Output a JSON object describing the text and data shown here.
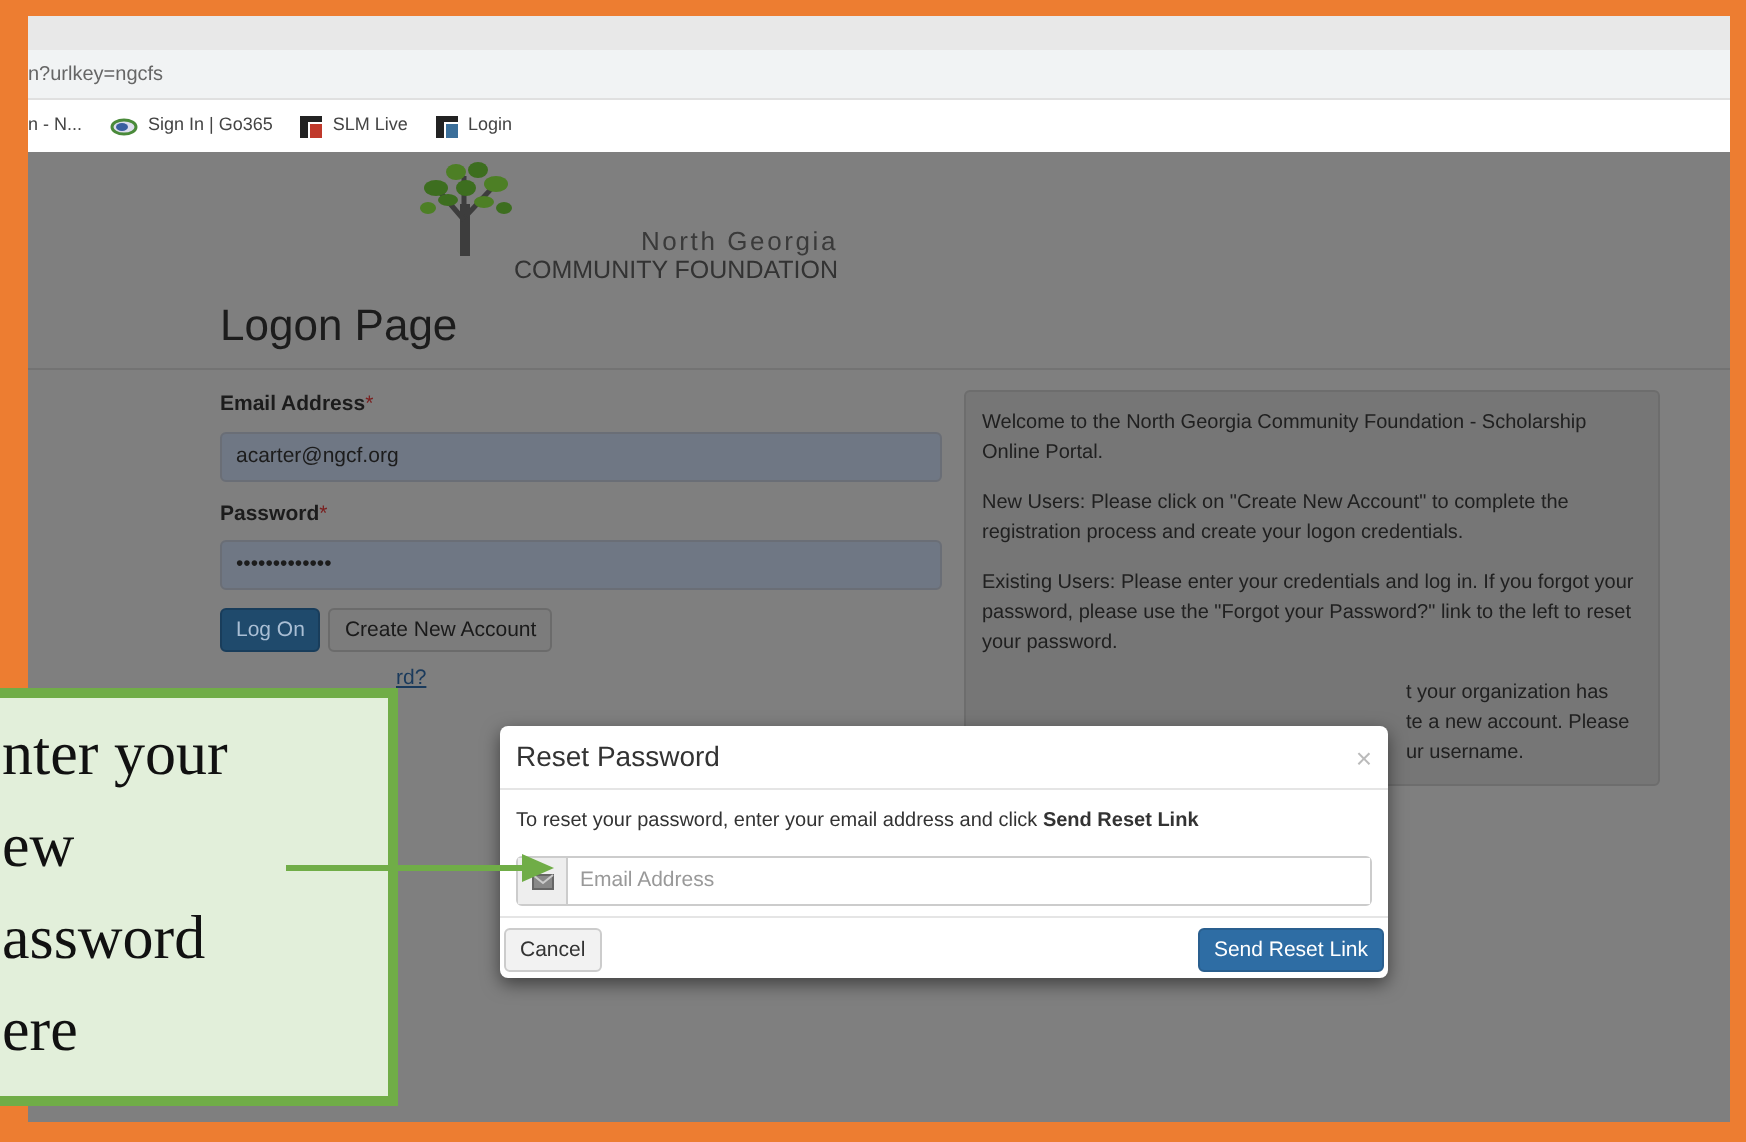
{
  "browser": {
    "address": "n?urlkey=ngcfs",
    "bookmarks": [
      {
        "label": "n - N...",
        "kind": "text"
      },
      {
        "label": "Sign In | Go365",
        "kind": "oval"
      },
      {
        "label": "SLM Live",
        "kind": "tile",
        "color": "#c0392b"
      },
      {
        "label": "Login",
        "kind": "tile",
        "color": "#3b6f9a"
      }
    ]
  },
  "logo": {
    "line_1": "North Georgia",
    "line_2": "COMMUNITY FOUNDATION"
  },
  "heading": "Logon Page",
  "fields": [
    {
      "label": "Email Address",
      "marker": "*",
      "value": "acarter@ngcf.org"
    },
    {
      "label": "Password",
      "marker": "*",
      "value": "•••••••••••••"
    }
  ],
  "buttons": [
    {
      "label": "Log On",
      "kind": "primary"
    },
    {
      "label": "Create New Account",
      "kind": "default"
    }
  ],
  "forgot_link": "rd?",
  "info_panel": {
    "paragraphs": [
      "Welcome to the North Georgia Community Foundation - Scholarship Online Portal.",
      "New Users: Please click on \"Create New Account\" to complete the registration process and create your logon credentials.",
      "Existing Users: Please enter your credentials and log in. If you forgot your password, please use the \"Forgot your Password?\" link to the left to reset your password."
    ],
    "partial_lines": [
      "t your organization has",
      "te a new account. Please",
      "ur username."
    ]
  },
  "modal": {
    "title": "Reset Password",
    "close": "×",
    "instructions": "To reset your password, enter your email address and click **Send Reset Link**",
    "placeholder": "Email Address",
    "buttons": [
      {
        "label": "Cancel",
        "kind": "default"
      },
      {
        "label": "Send Reset Link",
        "kind": "primary"
      }
    ]
  },
  "callout": {
    "lines": [
      "nter your",
      "ew",
      "assword",
      "ere"
    ]
  }
}
